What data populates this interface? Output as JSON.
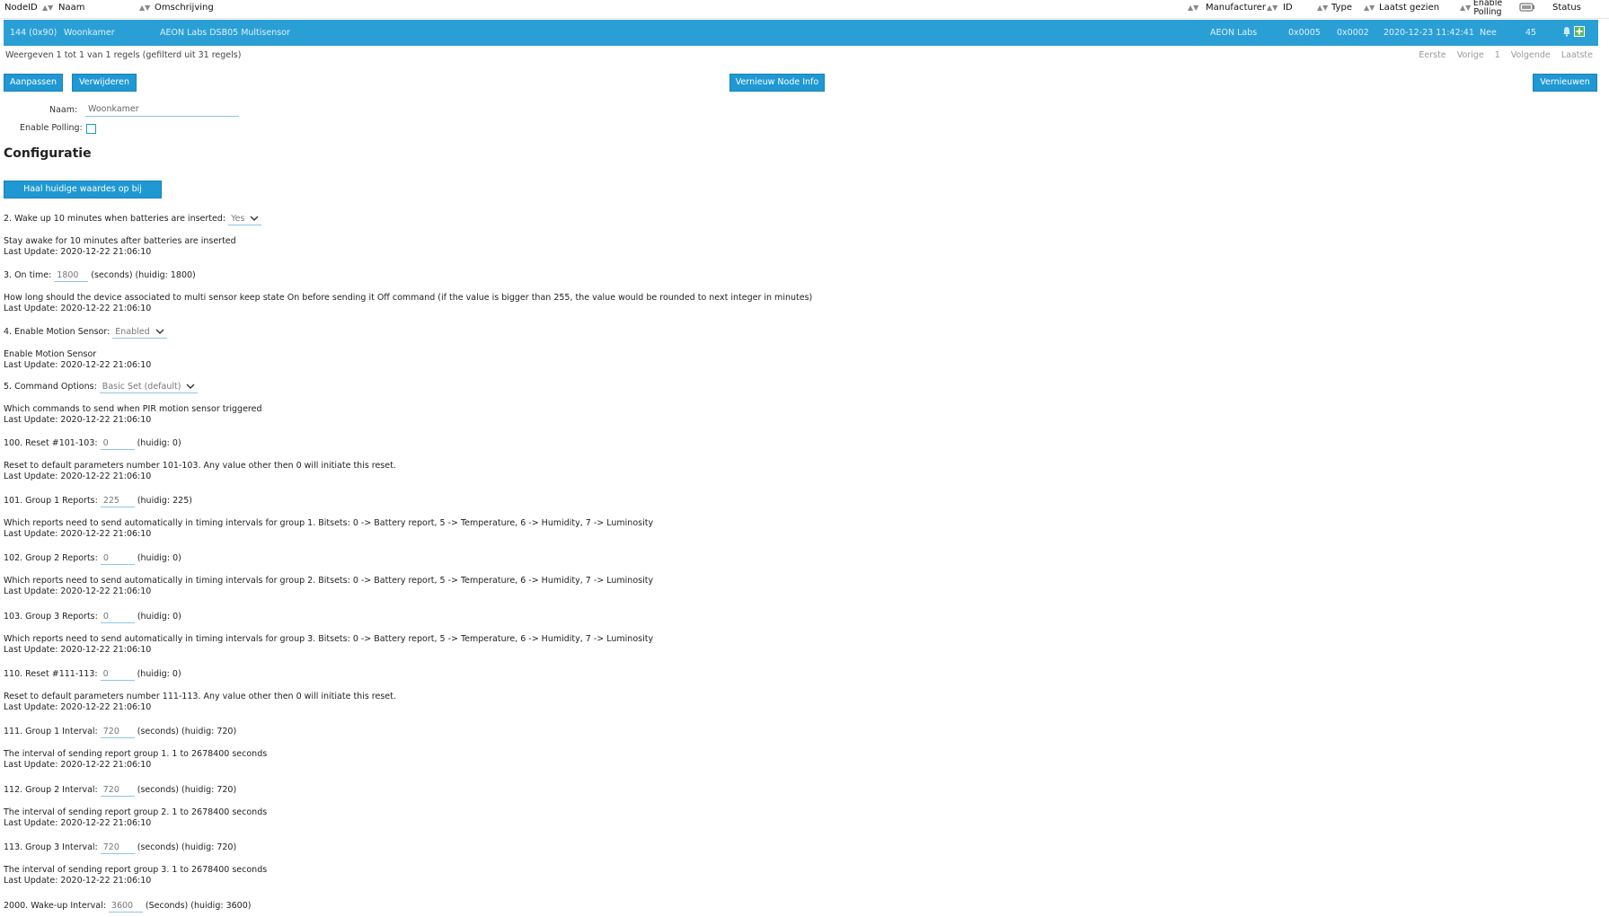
{
  "table": {
    "headers": {
      "nodeid": "NodeID",
      "naam": "Naam",
      "omschrijving": "Omschrijving",
      "manufacturer": "Manufacturer",
      "id": "ID",
      "type": "Type",
      "laatst_gezien": "Laatst gezien",
      "enable_polling_1": "Enable",
      "enable_polling_2": "Polling",
      "status": "Status"
    },
    "row": {
      "nodeid": "144 (0x90)",
      "naam": "Woonkamer",
      "omschrijving": "AEON Labs DSB05 Multisensor",
      "manufacturer": "AEON Labs",
      "id": "0x0005",
      "type": "0x0002",
      "laatst_gezien": "2020-12-23 11:42:41",
      "polling": "Nee",
      "battery": "45"
    },
    "info": "Weergeven 1 tot 1 van 1 regels (gefilterd uit 31 regels)",
    "pager": {
      "first": "Eerste",
      "prev": "Vorige",
      "page": "1",
      "next": "Volgende",
      "last": "Laatste"
    }
  },
  "buttons": {
    "aanpassen": "Aanpassen",
    "verwijderen": "Verwijderen",
    "vernieuw_node_info": "Vernieuw Node Info",
    "vernieuwen": "Vernieuwen",
    "haal_waardes": "Haal huidige waardes op bij apparaat"
  },
  "form": {
    "naam_label": "Naam:",
    "naam_value": "Woonkamer",
    "polling_label": "Enable Polling:",
    "polling_checked": false
  },
  "section_title": "Configuratie",
  "params": [
    {
      "prefix": "2. Wake up 10 minutes when batteries are inserted:",
      "select": "Yes",
      "desc": "Stay awake for 10 minutes after batteries are inserted",
      "update": "Last Update: 2020-12-22 21:06:10"
    },
    {
      "prefix": "3. On time:",
      "value": "1800",
      "suffix": "(seconds) (huidig: 1800)",
      "desc": "How long should the device associated to multi sensor keep state On before sending it Off command (if the value is bigger than 255, the value would be rounded to next integer in minutes)",
      "update": "Last Update: 2020-12-22 21:06:10"
    },
    {
      "prefix": "4. Enable Motion Sensor:",
      "select": "Enabled",
      "desc": "Enable Motion Sensor",
      "update": "Last Update: 2020-12-22 21:06:10"
    },
    {
      "prefix": "5. Command Options:",
      "select": "Basic Set (default)",
      "desc": "Which commands to send when PIR motion sensor triggered",
      "update": "Last Update: 2020-12-22 21:06:10"
    },
    {
      "prefix": "100. Reset #101-103:",
      "value": "0",
      "suffix": "(huidig: 0)",
      "desc": "Reset to default parameters number 101-103. Any value other then 0 will initiate this reset.",
      "update": "Last Update: 2020-12-22 21:06:10"
    },
    {
      "prefix": "101. Group 1 Reports:",
      "value": "225",
      "suffix": "(huidig: 225)",
      "desc": "Which reports need to send automatically in timing intervals for group 1. Bitsets: 0 -> Battery report, 5 -> Temperature, 6 -> Humidity, 7 -> Luminosity",
      "update": "Last Update: 2020-12-22 21:06:10"
    },
    {
      "prefix": "102. Group 2 Reports:",
      "value": "0",
      "suffix": "(huidig: 0)",
      "desc": "Which reports need to send automatically in timing intervals for group 2. Bitsets: 0 -> Battery report, 5 -> Temperature, 6 -> Humidity, 7 -> Luminosity",
      "update": "Last Update: 2020-12-22 21:06:10"
    },
    {
      "prefix": "103. Group 3 Reports:",
      "value": "0",
      "suffix": "(huidig: 0)",
      "desc": "Which reports need to send automatically in timing intervals for group 3. Bitsets: 0 -> Battery report, 5 -> Temperature, 6 -> Humidity, 7 -> Luminosity",
      "update": "Last Update: 2020-12-22 21:06:10"
    },
    {
      "prefix": "110. Reset #111-113:",
      "value": "0",
      "suffix": "(huidig: 0)",
      "desc": "Reset to default parameters number 111-113. Any value other then 0 will initiate this reset.",
      "update": "Last Update: 2020-12-22 21:06:10"
    },
    {
      "prefix": "111. Group 1 Interval:",
      "value": "720",
      "suffix": "(seconds) (huidig: 720)",
      "desc": "The interval of sending report group 1. 1 to 2678400 seconds",
      "update": "Last Update: 2020-12-22 21:06:10"
    },
    {
      "prefix": "112. Group 2 Interval:",
      "value": "720",
      "suffix": "(seconds) (huidig: 720)",
      "desc": "The interval of sending report group 2. 1 to 2678400 seconds",
      "update": "Last Update: 2020-12-22 21:06:10"
    },
    {
      "prefix": "113. Group 3 Interval:",
      "value": "720",
      "suffix": "(seconds) (huidig: 720)",
      "desc": "The interval of sending report group 3. 1 to 2678400 seconds",
      "update": "Last Update: 2020-12-22 21:06:10"
    },
    {
      "prefix": "2000. Wake-up Interval:",
      "value": "3600",
      "suffix": "(Seconds) (huidig: 3600)"
    }
  ],
  "colors": {
    "accent": "#1f98d3",
    "selected_row": "#2a9fd6",
    "plus_icon": "#5cb85c"
  }
}
